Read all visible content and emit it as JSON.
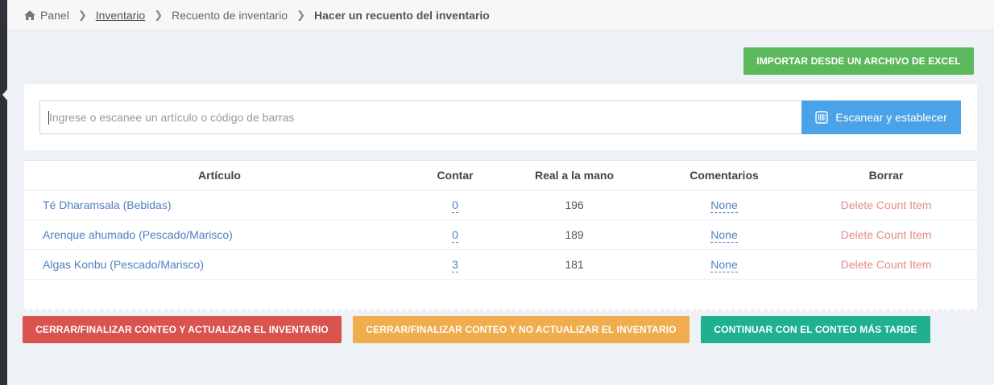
{
  "breadcrumb": {
    "home": "Panel",
    "inventory": "Inventario",
    "count": "Recuento de inventario",
    "current": "Hacer un recuento del inventario"
  },
  "import_button": "IMPORTAR DESDE UN ARCHIVO DE EXCEL",
  "search": {
    "placeholder": "Ingrese o escanee un artículo o código de barras",
    "value": "",
    "scan_button": "Escanear y establecer"
  },
  "table": {
    "headers": [
      "Artículo",
      "Contar",
      "Real a la mano",
      "Comentarios",
      "Borrar"
    ],
    "rows": [
      {
        "item": "Té Dharamsala (Bebidas)",
        "count": "0",
        "on_hand": "196",
        "comments": "None",
        "delete": "Delete Count Item"
      },
      {
        "item": "Arenque ahumado (Pescado/Marisco)",
        "count": "0",
        "on_hand": "189",
        "comments": "None",
        "delete": "Delete Count Item"
      },
      {
        "item": "Algas Konbu (Pescado/Marisco)",
        "count": "3",
        "on_hand": "181",
        "comments": "None",
        "delete": "Delete Count Item"
      }
    ]
  },
  "actions": {
    "close_update": "CERRAR/FINALIZAR CONTEO Y ACTUALIZAR EL INVENTARIO",
    "close_no_update": "CERRAR/FINALIZAR CONTEO Y NO ACTUALIZAR EL INVENTARIO",
    "continue_later": "CONTINUAR CON EL CONTEO MÁS TARDE"
  },
  "colors": {
    "import": "#5cb85c",
    "scan": "#4aa3e8",
    "danger": "#d9534f",
    "warning": "#f0ad4e",
    "success": "#1fb08f",
    "link": "#4f7fc2",
    "delete": "#e38a8a"
  },
  "icons": {
    "home": "home-icon",
    "separator": "chevron-right-icon",
    "scan": "barcode-icon"
  }
}
